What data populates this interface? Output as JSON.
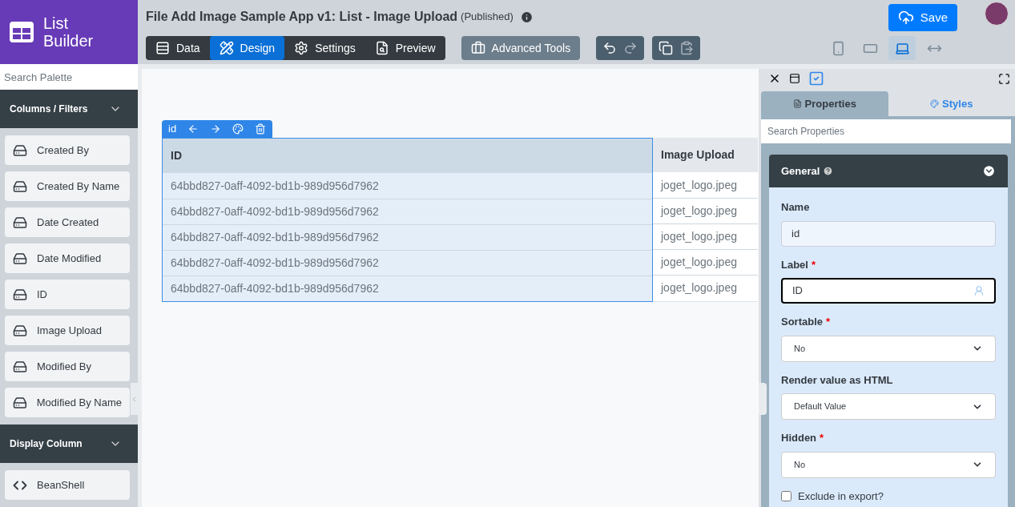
{
  "logo": {
    "text": "List Builder"
  },
  "header": {
    "title": "File Add Image Sample App v1: List - Image Upload",
    "status": "(Published)"
  },
  "mode_tabs": [
    {
      "kind": "data",
      "label": "Data",
      "selected": false
    },
    {
      "kind": "design",
      "label": "Design",
      "selected": true
    },
    {
      "kind": "settings",
      "label": "Settings",
      "selected": false
    },
    {
      "kind": "preview",
      "label": "Preview",
      "selected": false
    }
  ],
  "advanced_tools": {
    "label": "Advanced Tools"
  },
  "save": {
    "label": "Save"
  },
  "viewports": [
    {
      "kind": "phone",
      "selected": false
    },
    {
      "kind": "tablet",
      "selected": false
    },
    {
      "kind": "laptop",
      "selected": true
    },
    {
      "kind": "full",
      "selected": false
    }
  ],
  "palette": {
    "search_placeholder": "Search Palette",
    "sections": [
      {
        "title": "Columns / Filters",
        "items": [
          {
            "kind": "field",
            "label": "Created By"
          },
          {
            "kind": "field",
            "label": "Created By Name"
          },
          {
            "kind": "field",
            "label": "Date Created"
          },
          {
            "kind": "field",
            "label": "Date Modified"
          },
          {
            "kind": "field",
            "label": "ID"
          },
          {
            "kind": "field",
            "label": "Image Upload"
          },
          {
            "kind": "field",
            "label": "Modified By"
          },
          {
            "kind": "field",
            "label": "Modified By Name"
          }
        ]
      },
      {
        "title": "Display Column",
        "items": [
          {
            "kind": "code",
            "label": "BeanShell"
          }
        ]
      }
    ]
  },
  "table": {
    "toolbar_label": "id",
    "columns": [
      {
        "label": "ID",
        "selected": true
      },
      {
        "label": "Image Upload",
        "selected": false
      }
    ],
    "rows": [
      [
        "64bbd827-0aff-4092-bd1b-989d956d7962",
        "joget_logo.jpeg"
      ],
      [
        "64bbd827-0aff-4092-bd1b-989d956d7962",
        "joget_logo.jpeg"
      ],
      [
        "64bbd827-0aff-4092-bd1b-989d956d7962",
        "joget_logo.jpeg"
      ],
      [
        "64bbd827-0aff-4092-bd1b-989d956d7962",
        "joget_logo.jpeg"
      ],
      [
        "64bbd827-0aff-4092-bd1b-989d956d7962",
        "joget_logo.jpeg"
      ]
    ]
  },
  "properties": {
    "tabs": [
      {
        "kind": "properties",
        "label": "Properties",
        "selected": true
      },
      {
        "kind": "styles",
        "label": "Styles",
        "selected": false
      }
    ],
    "search_placeholder": "Search Properties",
    "section": "General",
    "fields": [
      {
        "kind": "text",
        "label": "Name",
        "value": "id",
        "focused": false
      },
      {
        "kind": "text",
        "label": "Label",
        "required_mark": "*",
        "value": "ID",
        "focused": true
      },
      {
        "kind": "select",
        "label": "Sortable",
        "required_mark": "*",
        "value": "No"
      },
      {
        "kind": "select",
        "label": "Render value as HTML",
        "value": "Default Value"
      },
      {
        "kind": "select",
        "label": "Hidden",
        "required_mark": "*",
        "value": "No"
      },
      {
        "kind": "checkbox",
        "label": "Exclude in export?",
        "checked": false
      }
    ]
  }
}
